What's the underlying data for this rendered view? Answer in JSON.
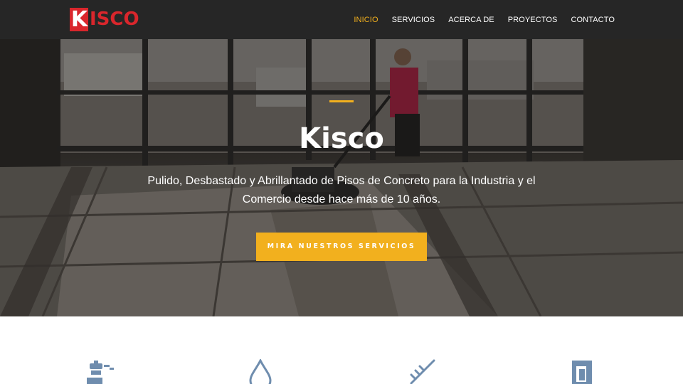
{
  "brand": {
    "logo_initial": "K",
    "logo_rest": "ISCO",
    "color_primary": "#d9262c",
    "color_accent": "#f2b01e",
    "color_nav_bg": "#262626"
  },
  "nav": {
    "items": [
      {
        "label": "INICIO",
        "active": true
      },
      {
        "label": "SERVICIOS",
        "active": false
      },
      {
        "label": "ACERCA DE",
        "active": false
      },
      {
        "label": "PROYECTOS",
        "active": false
      },
      {
        "label": "CONTACTO",
        "active": false
      }
    ]
  },
  "hero": {
    "title": "Kisco",
    "subtitle": "Pulido, Desbastado y Abrillantado de Pisos de Concreto para la Industria y el Comercio desde hace más de 10 años.",
    "cta_label": "MIRA NUESTROS SERVICIOS",
    "background_image": "worker-polishing-concrete-floor-photo"
  },
  "services": {
    "icons": [
      {
        "name": "floor-machine-icon"
      },
      {
        "name": "water-drop-icon"
      },
      {
        "name": "caulking-gun-icon"
      },
      {
        "name": "concrete-tile-icon"
      }
    ],
    "icon_color": "#6f8dae"
  }
}
